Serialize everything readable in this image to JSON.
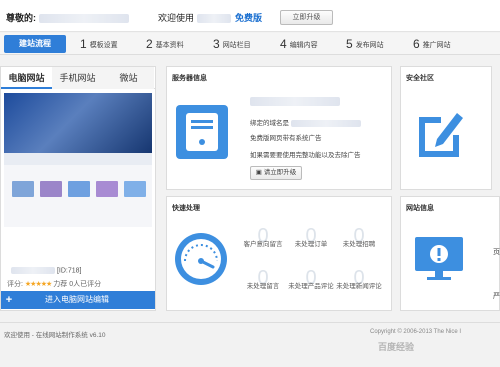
{
  "header": {
    "greeting": "尊敬的",
    "welcome": "欢迎使用",
    "edition": "免费版",
    "upgrade_button": "立即升级"
  },
  "steps": {
    "active": "建站流程",
    "items": [
      {
        "num": "1",
        "label": "模板设置"
      },
      {
        "num": "2",
        "label": "基本资料"
      },
      {
        "num": "3",
        "label": "网站栏目"
      },
      {
        "num": "4",
        "label": "编辑内容"
      },
      {
        "num": "5",
        "label": "发布网站"
      },
      {
        "num": "6",
        "label": "推广网站"
      }
    ]
  },
  "site_panel": {
    "tabs": [
      "电脑网站",
      "手机网站",
      "微站"
    ],
    "id_label": "[ID:718]",
    "rating_label": "评分:",
    "stars": "★★★★★",
    "rating_detail": "力荐  0人已评分",
    "enter_button": "进入电脑网站编辑"
  },
  "server_panel": {
    "title": "服务器信息",
    "bound_domain": "绑定的域名是",
    "ad_notice": "免费版网页带有系统广告",
    "remove_ad": "如果需要要使用完整功能以及去除广告",
    "renew_button": "请立即升级"
  },
  "safety_panel": {
    "title": "安全社区"
  },
  "quick_panel": {
    "title": "快速处理",
    "items": [
      {
        "count": "0",
        "label": "客户意向留言"
      },
      {
        "count": "0",
        "label": "未处理订单"
      },
      {
        "count": "0",
        "label": "未处理招聘"
      },
      {
        "count": "0",
        "label": "未处理留言"
      },
      {
        "count": "0",
        "label": "未处理产品评论"
      },
      {
        "count": "0",
        "label": "未处理新闻评论"
      }
    ]
  },
  "site_info_panel": {
    "title": "网站信息",
    "side_char_1": "页",
    "side_char_2": "严"
  },
  "footer": {
    "text": "欢迎使用    - 在线网站制作系统 v6.10",
    "copyright": "Copyright © 2006-2013 The Nice I"
  },
  "watermark": "百度经验"
}
